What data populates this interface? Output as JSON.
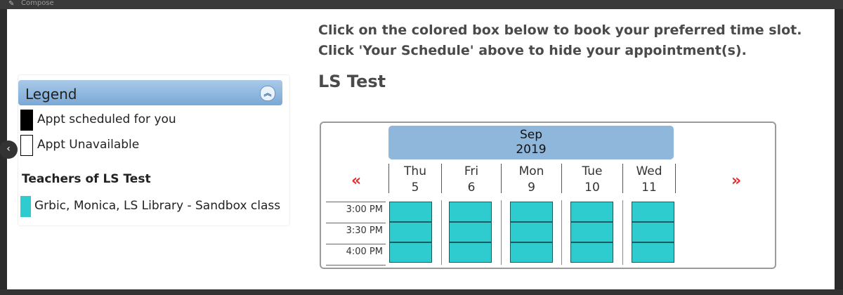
{
  "background": {
    "compose_label": "Compose"
  },
  "legend": {
    "title": "Legend",
    "items": [
      {
        "label": "Appt scheduled for you",
        "swatch": "#000000"
      },
      {
        "label": "Appt Unavailable",
        "swatch": "#ffffff"
      }
    ],
    "teachers_title": "Teachers of LS Test",
    "teachers": [
      {
        "label": "Grbic, Monica, LS Library - Sandbox class",
        "swatch": "#2ecccf"
      }
    ]
  },
  "instructions": {
    "line1": "Click on the colored box below to book your preferred time slot.",
    "line2": "Click 'Your Schedule' above to hide your appointment(s)."
  },
  "event": {
    "title": "LS Test"
  },
  "calendar": {
    "month": "Sep",
    "year": "2019",
    "prev_label": "«",
    "next_label": "»",
    "days": [
      {
        "name": "Thu",
        "date": "5"
      },
      {
        "name": "Fri",
        "date": "6"
      },
      {
        "name": "Mon",
        "date": "9"
      },
      {
        "name": "Tue",
        "date": "10"
      },
      {
        "name": "Wed",
        "date": "11"
      }
    ],
    "times": [
      "3:00 PM",
      "3:30 PM",
      "4:00 PM"
    ],
    "slot_color": "#2ecccf"
  },
  "icons": {
    "collapse": "double-chevron-up-icon",
    "prev": "double-chevron-left-icon",
    "next": "double-chevron-right-icon",
    "side_nav": "chevron-left-icon"
  }
}
